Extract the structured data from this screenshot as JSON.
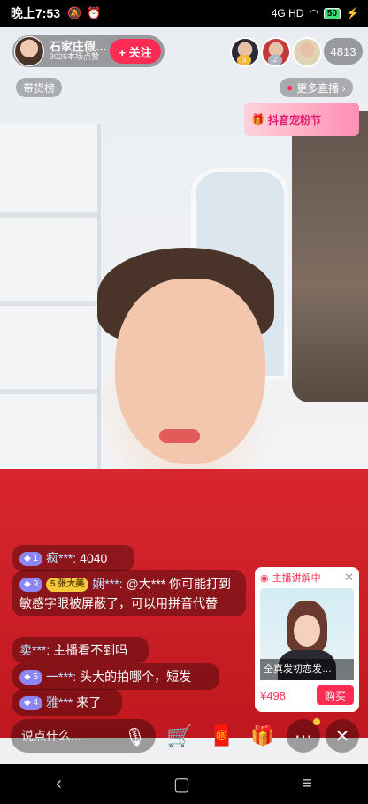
{
  "status_bar": {
    "time": "晚上7:53",
    "signal": "4G HD",
    "battery": "50"
  },
  "host": {
    "name": "石家庄假…",
    "sub": "3026本场点赞",
    "follow_label": "+ 关注"
  },
  "viewers": {
    "badges": [
      "3",
      "2"
    ],
    "count": "4813"
  },
  "chips": {
    "sales_rank": "带货榜",
    "more_live": "更多直播 ›"
  },
  "promo": {
    "text": "抖音宠粉节"
  },
  "chat": [
    {
      "level": "1",
      "user": "疯***:",
      "text": "4040"
    },
    {
      "level": "9",
      "fan": "5 张大美",
      "user": "娴***:",
      "text": "@大*** 你可能打到敏感字眼被屏蔽了，可以用拼音代替"
    },
    {
      "user": "卖***:",
      "text": "主播看不到吗"
    },
    {
      "level": "5",
      "user": "一***:",
      "text": "头大的拍哪个，短发"
    },
    {
      "level": "4",
      "user": "雅***",
      "text": "来了"
    }
  ],
  "product": {
    "header": "主播讲解中",
    "title": "全真发初恋发…",
    "price": "¥498",
    "buy_label": "购买"
  },
  "bottom": {
    "input_placeholder": "说点什么..."
  },
  "colors": {
    "accent": "#fe2c55",
    "level_badge": "#8c86f5",
    "fan_badge": "#f5c83a"
  }
}
